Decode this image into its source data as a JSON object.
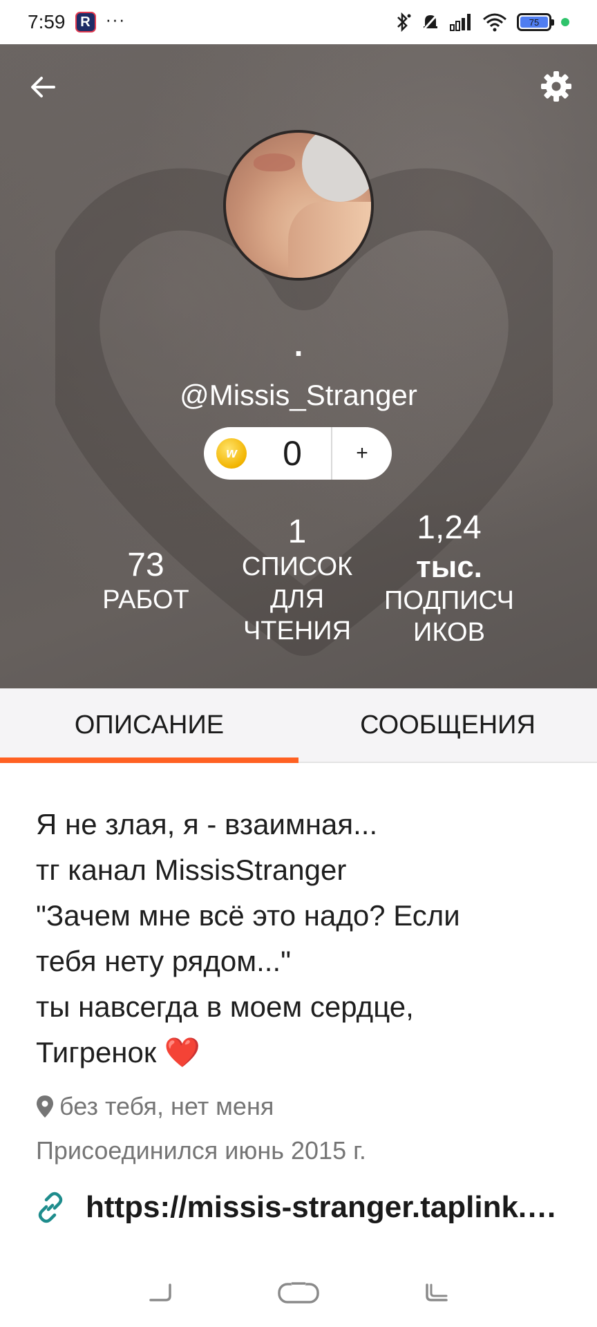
{
  "status_bar": {
    "time": "7:59",
    "app_badge": "R",
    "more": "···",
    "battery": "75"
  },
  "profile": {
    "display_name": ".",
    "username": "@Missis_Stranger",
    "coins": "0",
    "coin_icon_letter": "w",
    "add_label": "+",
    "stats": {
      "works_value": "73",
      "works_label": "РАБОТ",
      "lists_value": "1",
      "lists_label_1": "СПИСОК",
      "lists_label_2": "ДЛЯ",
      "lists_label_3": "ЧТЕНИЯ",
      "followers_value": "1,24",
      "followers_value_2": "тыс.",
      "followers_label_1": "ПОДПИСЧ",
      "followers_label_2": "ИКОВ"
    }
  },
  "tabs": {
    "description": "ОПИСАНИЕ",
    "messages": "СООБЩЕНИЯ",
    "active": "description"
  },
  "about": {
    "bio_lines": [
      "Я не злая, я - взаимная...",
      "тг канал MissisStranger",
      "\"Зачем мне всё это надо? Если",
      "тебя нету рядом...\"",
      "ты навсегда в моем сердце,",
      "Тигренок"
    ],
    "heart": "❤️",
    "location": "без тебя, нет меня",
    "joined": "Присоединился июнь 2015 г.",
    "link": "https://missis-stranger.taplink.ws"
  },
  "colors": {
    "accent": "#ff6122",
    "header_bg": "#625d5a",
    "link_icon": "#1e8c8c"
  },
  "icons": {
    "back": "arrow-left-icon",
    "settings": "gear-icon",
    "location": "location-pin-icon",
    "link": "link-icon"
  }
}
